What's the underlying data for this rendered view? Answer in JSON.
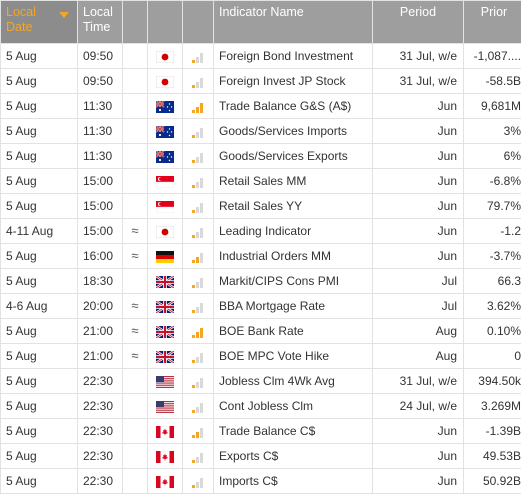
{
  "headers": {
    "date": "Local Date",
    "time": "Local Time",
    "name": "Indicator Name",
    "period": "Period",
    "prior": "Prior"
  },
  "colors": {
    "header_bg": "#9e9e9e",
    "sorted_header_text": "#f5a623",
    "importance_active": "#f5a623",
    "importance_inactive": "#d9d9d9"
  },
  "rows": [
    {
      "date": "5 Aug",
      "time": "09:50",
      "approx": "",
      "flag": "jp-flag-icon",
      "importance": 1,
      "name": "Foreign Bond Investment",
      "period": "31 Jul, w/e",
      "prior": "-1,087...."
    },
    {
      "date": "5 Aug",
      "time": "09:50",
      "approx": "",
      "flag": "jp-flag-icon",
      "importance": 1,
      "name": "Foreign Invest JP Stock",
      "period": "31 Jul, w/e",
      "prior": "-58.5B"
    },
    {
      "date": "5 Aug",
      "time": "11:30",
      "approx": "",
      "flag": "au-flag-icon",
      "importance": 3,
      "name": "Trade Balance G&S (A$)",
      "period": "Jun",
      "prior": "9,681M"
    },
    {
      "date": "5 Aug",
      "time": "11:30",
      "approx": "",
      "flag": "au-flag-icon",
      "importance": 1,
      "name": "Goods/Services Imports",
      "period": "Jun",
      "prior": "3%"
    },
    {
      "date": "5 Aug",
      "time": "11:30",
      "approx": "",
      "flag": "au-flag-icon",
      "importance": 1,
      "name": "Goods/Services Exports",
      "period": "Jun",
      "prior": "6%"
    },
    {
      "date": "5 Aug",
      "time": "15:00",
      "approx": "",
      "flag": "sg-flag-icon",
      "importance": 1,
      "name": "Retail Sales MM",
      "period": "Jun",
      "prior": "-6.8%"
    },
    {
      "date": "5 Aug",
      "time": "15:00",
      "approx": "",
      "flag": "sg-flag-icon",
      "importance": 1,
      "name": "Retail Sales YY",
      "period": "Jun",
      "prior": "79.7%"
    },
    {
      "date": "4-11 Aug",
      "time": "15:00",
      "approx": "≈",
      "flag": "jp-flag-icon",
      "importance": 1,
      "name": "Leading Indicator",
      "period": "Jun",
      "prior": "-1.2"
    },
    {
      "date": "5 Aug",
      "time": "16:00",
      "approx": "≈",
      "flag": "de-flag-icon",
      "importance": 2,
      "name": "Industrial Orders MM",
      "period": "Jun",
      "prior": "-3.7%"
    },
    {
      "date": "5 Aug",
      "time": "18:30",
      "approx": "",
      "flag": "gb-flag-icon",
      "importance": 1,
      "name": "Markit/CIPS Cons PMI",
      "period": "Jul",
      "prior": "66.3"
    },
    {
      "date": "4-6 Aug",
      "time": "20:00",
      "approx": "≈",
      "flag": "gb-flag-icon",
      "importance": 1,
      "name": "BBA Mortgage Rate",
      "period": "Jul",
      "prior": "3.62%"
    },
    {
      "date": "5 Aug",
      "time": "21:00",
      "approx": "≈",
      "flag": "gb-flag-icon",
      "importance": 3,
      "name": "BOE Bank Rate",
      "period": "Aug",
      "prior": "0.10%"
    },
    {
      "date": "5 Aug",
      "time": "21:00",
      "approx": "≈",
      "flag": "gb-flag-icon",
      "importance": 1,
      "name": "BOE MPC Vote Hike",
      "period": "Aug",
      "prior": "0"
    },
    {
      "date": "5 Aug",
      "time": "22:30",
      "approx": "",
      "flag": "us-flag-icon",
      "importance": 1,
      "name": "Jobless Clm 4Wk Avg",
      "period": "31 Jul, w/e",
      "prior": "394.50k"
    },
    {
      "date": "5 Aug",
      "time": "22:30",
      "approx": "",
      "flag": "us-flag-icon",
      "importance": 1,
      "name": "Cont Jobless Clm",
      "period": "24 Jul, w/e",
      "prior": "3.269M"
    },
    {
      "date": "5 Aug",
      "time": "22:30",
      "approx": "",
      "flag": "ca-flag-icon",
      "importance": 2,
      "name": "Trade Balance C$",
      "period": "Jun",
      "prior": "-1.39B"
    },
    {
      "date": "5 Aug",
      "time": "22:30",
      "approx": "",
      "flag": "ca-flag-icon",
      "importance": 1,
      "name": "Exports C$",
      "period": "Jun",
      "prior": "49.53B"
    },
    {
      "date": "5 Aug",
      "time": "22:30",
      "approx": "",
      "flag": "ca-flag-icon",
      "importance": 1,
      "name": "Imports C$",
      "period": "Jun",
      "prior": "50.92B"
    }
  ]
}
